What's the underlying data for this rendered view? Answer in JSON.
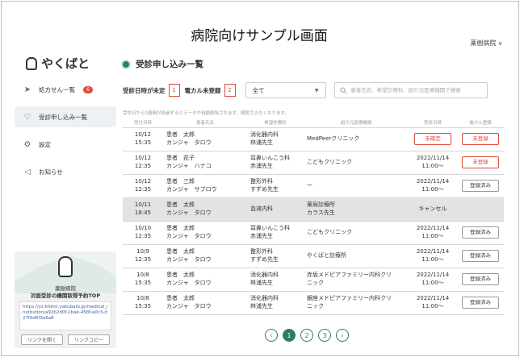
{
  "banner": "病院向けサンプル画面",
  "account": {
    "name": "薬樹病院",
    "chevron": "∨"
  },
  "sidebar": {
    "logo_text": "やくばと",
    "items": [
      {
        "label": "処方せん一覧",
        "icon": "send-icon",
        "glyph": "➤",
        "badge": "6"
      },
      {
        "label": "受診申し込み一覧",
        "icon": "stethoscope-icon",
        "glyph": "♡"
      },
      {
        "label": "設定",
        "icon": "gear-icon",
        "glyph": "⚙"
      },
      {
        "label": "お知らせ",
        "icon": "megaphone-icon",
        "glyph": "◁"
      }
    ],
    "promo": {
      "name": "薬樹病院",
      "title": "対面受診の機関取得予約TOP",
      "url": "https://yz.kfdmt.yakubato.jp/medical_institution/a92b2d0f-1bae-458f-a0c3-d27f0d6f3e6a8",
      "open_button": "リンクを開く",
      "copy_button": "リンクコピー"
    }
  },
  "main": {
    "title": "受診申し込み一覧",
    "filter_unset_label": "受診日時が未定",
    "filter_unset_count": "1",
    "filter_unregistered_label": "電カル未登録",
    "filter_unregistered_count": "2",
    "select_value": "全て",
    "search_placeholder": "患者氏名、希望診療科、紹介元医療機関で検索",
    "note": "受診日から3週間が経過するとデータが自動削除されます。閲覧できなくなります。",
    "columns": [
      "受付日時",
      "患者氏名",
      "希望診療科",
      "紹介元医療機関",
      "受診日時",
      "電カル登録"
    ],
    "rows": [
      {
        "date": "10/12",
        "time": "15:35",
        "name1": "患者　太郎",
        "name2": "カンジャ　タロウ",
        "dept1": "消化器内科",
        "dept2": "林浦先生",
        "ref1": "MedPeerクリニック",
        "ref2": "",
        "visit1": "未確定",
        "visit2": "",
        "reg": "未登録",
        "visit_style": "btn-red",
        "reg_style": "red"
      },
      {
        "date": "10/12",
        "time": "12:35",
        "name1": "患者　花子",
        "name2": "カンジャ　ハナコ",
        "dept1": "耳鼻いんこう科",
        "dept2": "赤浦先生",
        "ref1": "こどもクリニック",
        "ref2": "",
        "visit1": "2022/11/14",
        "visit2": "11:00～",
        "reg": "未登録",
        "visit_style": "",
        "reg_style": "red"
      },
      {
        "date": "10/12",
        "time": "12:35",
        "name1": "患者　三郎",
        "name2": "カンジャ　サブロウ",
        "dept1": "整形外科",
        "dept2": "すずめ先生",
        "ref1": "ー",
        "ref2": "",
        "visit1": "2022/11/14",
        "visit2": "11:00～",
        "reg": "登録済み",
        "visit_style": "",
        "reg_style": ""
      },
      {
        "date": "10/11",
        "time": "18:45",
        "name1": "患者　太郎",
        "name2": "カンジャ　タロウ",
        "dept1": "血液内科",
        "dept2": "",
        "ref1": "薬局診療所",
        "ref2": "カラス先生",
        "visit1": "キャンセル",
        "visit2": "",
        "reg": "",
        "visit_style": "",
        "reg_style": "none",
        "cancel": true
      },
      {
        "date": "10/10",
        "time": "12:35",
        "name1": "患者　太郎",
        "name2": "カンジャ　タロウ",
        "dept1": "耳鼻いんこう科",
        "dept2": "赤浦先生",
        "ref1": "こどもクリニック",
        "ref2": "",
        "visit1": "2022/11/14",
        "visit2": "11:00～",
        "reg": "登録済み",
        "visit_style": "",
        "reg_style": ""
      },
      {
        "date": "10/9",
        "time": "12:35",
        "name1": "患者　太郎",
        "name2": "カンジャ　タロウ",
        "dept1": "整形外科",
        "dept2": "すずめ先生",
        "ref1": "やくばと診療所",
        "ref2": "",
        "visit1": "2022/11/14",
        "visit2": "11:00～",
        "reg": "登録済み",
        "visit_style": "",
        "reg_style": ""
      },
      {
        "date": "10/8",
        "time": "15:35",
        "name1": "患者　太郎",
        "name2": "カンジャ　タロウ",
        "dept1": "消化器内科",
        "dept2": "林浦先生",
        "ref1": "赤坂メドピアファミリー内科クリ",
        "ref2": "ニック",
        "visit1": "2022/11/14",
        "visit2": "11:00～",
        "reg": "登録済み",
        "visit_style": "",
        "reg_style": ""
      },
      {
        "date": "10/8",
        "time": "15:35",
        "name1": "患者　太郎",
        "name2": "カンジャ　タロウ",
        "dept1": "消化器内科",
        "dept2": "林浦先生",
        "ref1": "銀座メドピアファミリー内科クリ",
        "ref2": "ニック",
        "visit1": "2022/11/14",
        "visit2": "11:00～",
        "reg": "登録済み",
        "visit_style": "",
        "reg_style": ""
      }
    ],
    "pagination": {
      "prev": "‹",
      "pages": [
        "1",
        "2",
        "3"
      ],
      "current": "1",
      "next": "›"
    }
  },
  "colors": {
    "accent": "#2e7d5b",
    "alert": "#e04b3f",
    "cancel_row": "#e3e3e3"
  }
}
